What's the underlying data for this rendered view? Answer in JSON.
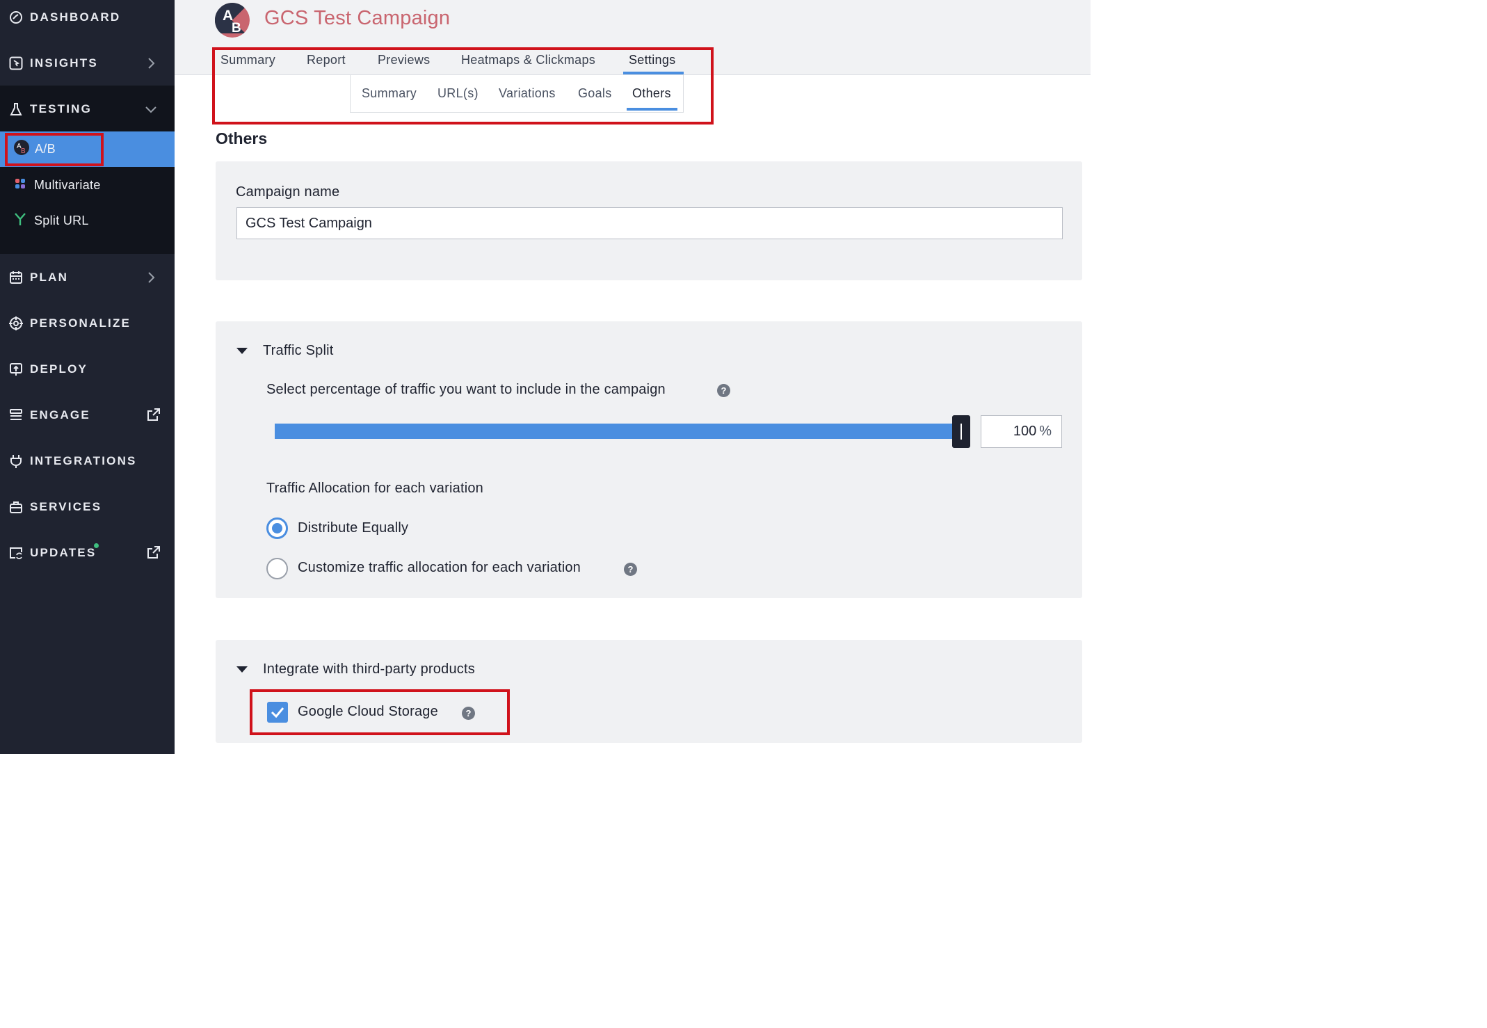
{
  "sidebar": {
    "items": [
      {
        "label": "DASHBOARD",
        "icon": "dashboard-gauge-icon"
      },
      {
        "label": "INSIGHTS",
        "icon": "insights-cursor-icon"
      },
      {
        "label": "TESTING",
        "icon": "flask-icon"
      },
      {
        "label": "PLAN",
        "icon": "calendar-icon"
      },
      {
        "label": "PERSONALIZE",
        "icon": "crosshair-icon"
      },
      {
        "label": "DEPLOY",
        "icon": "deploy-upload-icon"
      },
      {
        "label": "ENGAGE",
        "icon": "engage-stack-icon"
      },
      {
        "label": "INTEGRATIONS",
        "icon": "plug-icon"
      },
      {
        "label": "SERVICES",
        "icon": "briefcase-icon"
      },
      {
        "label": "UPDATES",
        "icon": "updates-refresh-icon"
      }
    ],
    "testing_sub": [
      {
        "label": "A/B",
        "icon": "ab-test-icon"
      },
      {
        "label": "Multivariate",
        "icon": "multivariate-grid-icon"
      },
      {
        "label": "Split URL",
        "icon": "split-url-icon"
      }
    ]
  },
  "header": {
    "logo_a": "A",
    "logo_b": "B",
    "title": "GCS Test Campaign",
    "tabs": [
      "Summary",
      "Report",
      "Previews",
      "Heatmaps & Clickmaps",
      "Settings"
    ],
    "subtabs": [
      "Summary",
      "URL(s)",
      "Variations",
      "Goals",
      "Others"
    ]
  },
  "main": {
    "section_title": "Others",
    "campaign_name_label": "Campaign name",
    "campaign_name_value": "GCS Test Campaign",
    "traffic_split": {
      "heading": "Traffic Split",
      "percent_label": "Select percentage of traffic you want to include in the campaign",
      "percent_value": "100",
      "percent_sign": "%",
      "allocation_label": "Traffic Allocation for each variation",
      "option_equal": "Distribute Equally",
      "option_custom": "Customize traffic allocation for each variation"
    },
    "integrations": {
      "heading": "Integrate with third-party products",
      "gcs_label": "Google Cloud Storage"
    },
    "help_glyph": "?"
  },
  "colors": {
    "accent": "#4a8ee0",
    "title": "#c9656f",
    "highlight": "#d0121b",
    "sidebar": "#1f2330"
  }
}
